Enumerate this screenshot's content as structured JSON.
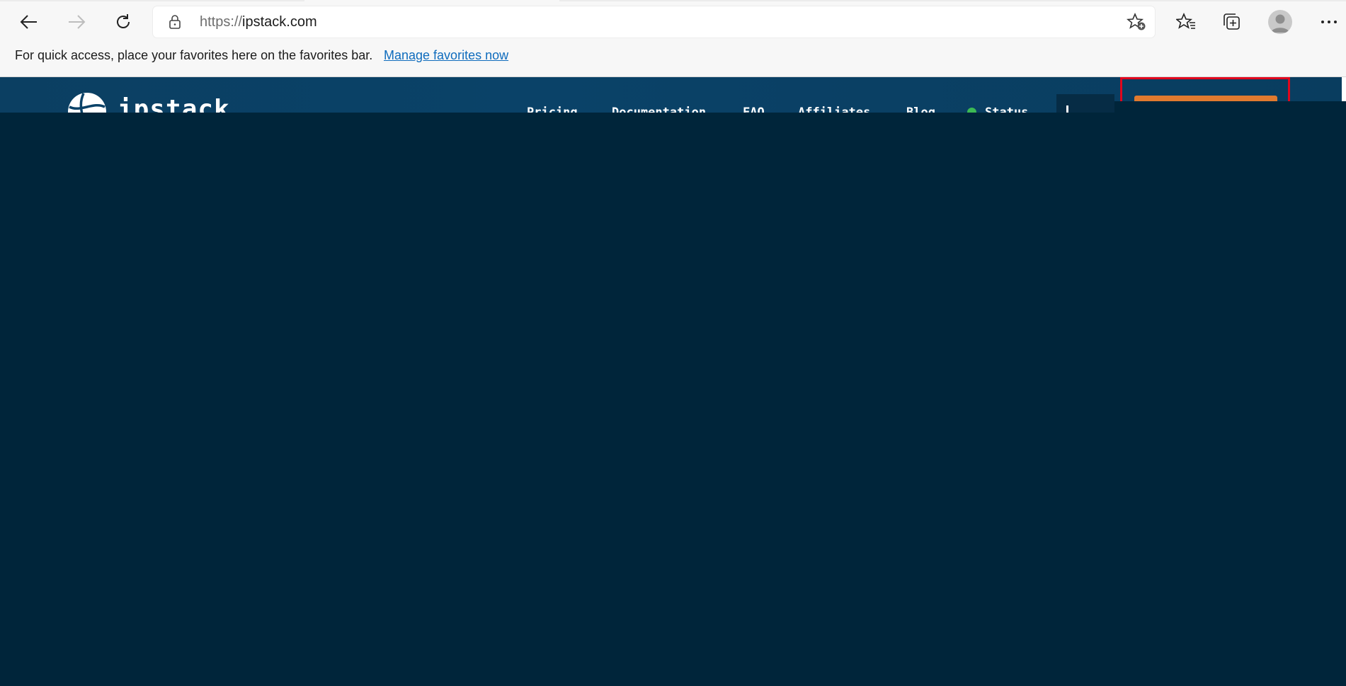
{
  "browser": {
    "address": {
      "scheme": "https://",
      "host": "ipstack.com"
    },
    "icons": {
      "back": "back-arrow-icon",
      "forward": "forward-arrow-icon",
      "refresh": "refresh-icon",
      "lock": "lock-icon",
      "add_favorite": "star-plus-icon",
      "favorites": "favorites-icon",
      "collections": "collections-icon",
      "profile": "profile-avatar-icon",
      "more": "more-dots-icon"
    },
    "favorites_bar": {
      "message": "For quick access, place your favorites here on the favorites bar.",
      "manage_link": "Manage favorites now"
    }
  },
  "site": {
    "logo_text": "ipstack",
    "nav": [
      {
        "label": "Pricing"
      },
      {
        "label": "Documentation"
      },
      {
        "label": "FAQ"
      },
      {
        "label": "Affiliates"
      },
      {
        "label": "Blog"
      },
      {
        "label": "Status"
      }
    ],
    "colors": {
      "header": "#0a4268",
      "overlay": "#00253a",
      "signup_button": "#e07a2f",
      "highlight_border": "#e0071d",
      "status_dot": "#3cba54"
    }
  }
}
